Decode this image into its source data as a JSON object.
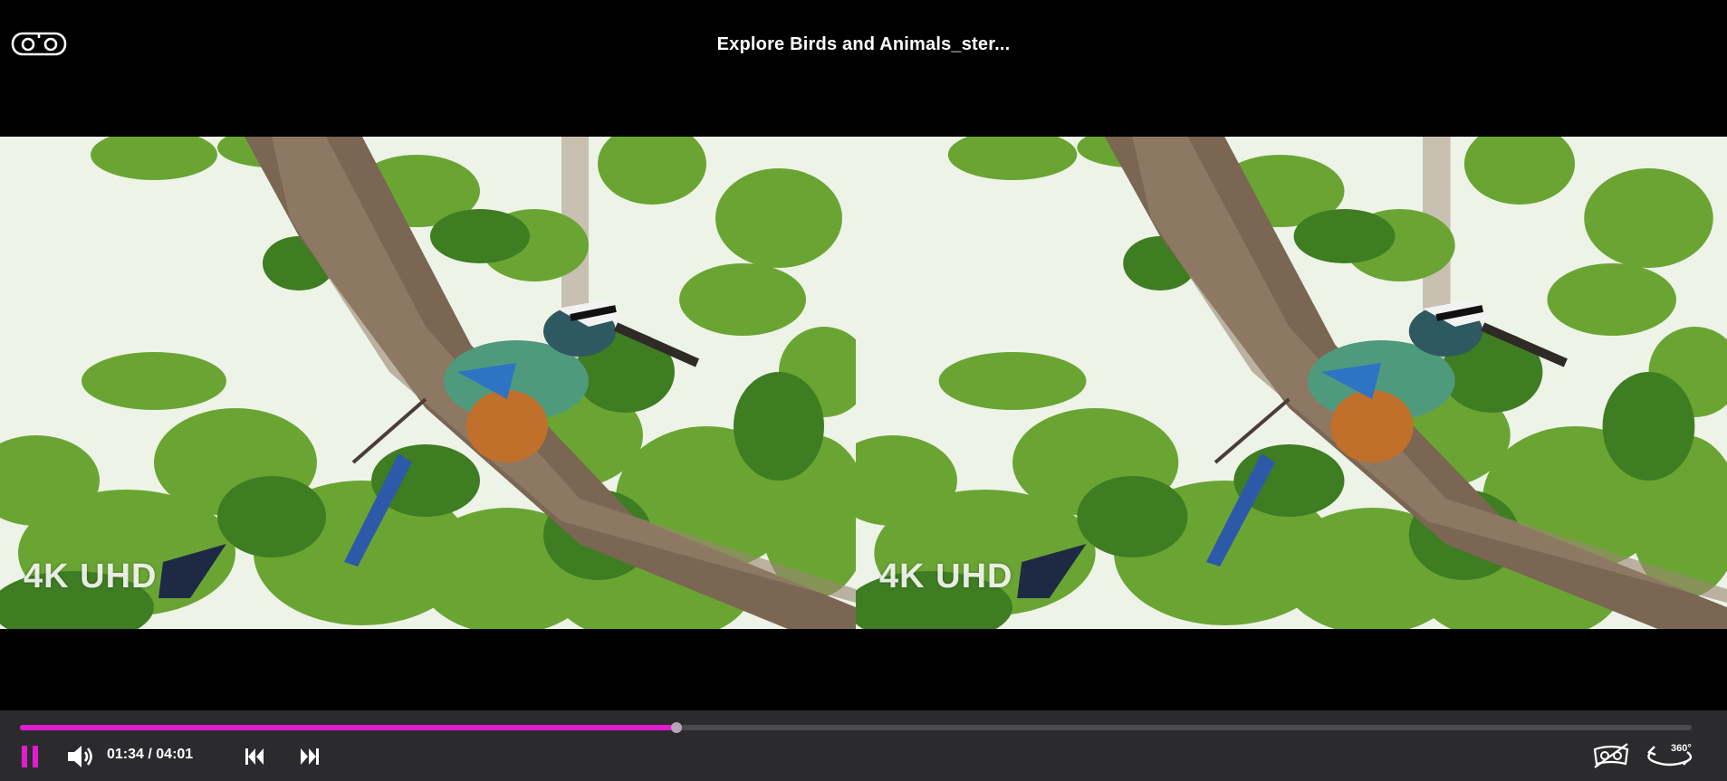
{
  "header": {
    "title": "Explore Birds and Animals_ster...",
    "vr_icon": "vr-goggles-icon"
  },
  "video": {
    "mode": "side-by-side stereo",
    "left_watermark": "4K UHD",
    "right_watermark": "4K UHD"
  },
  "controls": {
    "current_time": "01:34",
    "separator": " / ",
    "duration": "04:01",
    "progress": 0.393,
    "accent_color": "#e11cd0",
    "play_state_icon": "pause-icon",
    "volume_icon": "volume-icon",
    "prev_icon": "skip-previous-icon",
    "next_icon": "skip-next-icon",
    "stereo_toggle_icon": "3d-off-icon",
    "view_mode_label": "360°",
    "view_mode_icon": "360-view-icon"
  }
}
